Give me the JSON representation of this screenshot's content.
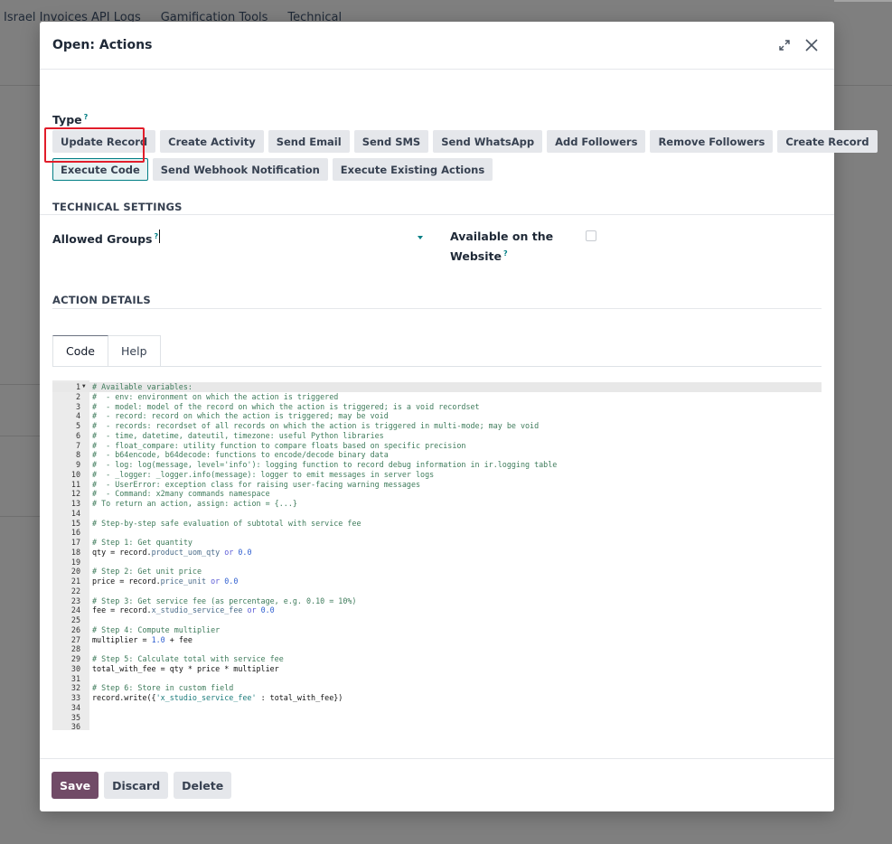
{
  "background": {
    "menu": [
      "Israel Invoices API Logs",
      "Gamification Tools",
      "Technical"
    ]
  },
  "modal": {
    "title": "Open: Actions",
    "expand_icon": "expand-icon",
    "close_icon": "close-icon"
  },
  "type_field": {
    "label": "Type",
    "help": "?",
    "row1": [
      "Update Record",
      "Create Activity",
      "Send Email",
      "Send SMS",
      "Send WhatsApp",
      "Add Followers",
      "Remove Followers",
      "Create Record"
    ],
    "row2": [
      "Execute Code",
      "Send Webhook Notification",
      "Execute Existing Actions"
    ],
    "selected": "Execute Code"
  },
  "technical_settings": {
    "title": "TECHNICAL SETTINGS",
    "allowed_groups_label": "Allowed Groups",
    "allowed_groups_value": "",
    "available_on_website_label_1": "Available on the",
    "available_on_website_label_2": "Website",
    "available_on_website_checked": false,
    "help": "?"
  },
  "action_details": {
    "title": "ACTION DETAILS",
    "tabs": [
      "Code",
      "Help"
    ],
    "active_tab": "Code"
  },
  "code_lines": [
    "# Available variables:",
    "#  - env: environment on which the action is triggered",
    "#  - model: model of the record on which the action is triggered; is a void recordset",
    "#  - record: record on which the action is triggered; may be void",
    "#  - records: recordset of all records on which the action is triggered in multi-mode; may be void",
    "#  - time, datetime, dateutil, timezone: useful Python libraries",
    "#  - float_compare: utility function to compare floats based on specific precision",
    "#  - b64encode, b64decode: functions to encode/decode binary data",
    "#  - log: log(message, level='info'): logging function to record debug information in ir.logging table",
    "#  - _logger: _logger.info(message): logger to emit messages in server logs",
    "#  - UserError: exception class for raising user-facing warning messages",
    "#  - Command: x2many commands namespace",
    "# To return an action, assign: action = {...}",
    "",
    "# Step-by-step safe evaluation of subtotal with service fee",
    "",
    "# Step 1: Get quantity",
    "qty = record.product_uom_qty or 0.0",
    "",
    "# Step 2: Get unit price",
    "price = record.price_unit or 0.0",
    "",
    "# Step 3: Get service fee (as percentage, e.g. 0.10 = 10%)",
    "fee = record.x_studio_service_fee or 0.0",
    "",
    "# Step 4: Compute multiplier",
    "multiplier = 1.0 + fee",
    "",
    "# Step 5: Calculate total with service fee",
    "total_with_fee = qty * price * multiplier",
    "",
    "# Step 6: Store in custom field",
    "record.write({'x_studio_service_fee' : total_with_fee})",
    "",
    "",
    ""
  ],
  "footer": {
    "save": "Save",
    "discard": "Discard",
    "delete": "Delete"
  },
  "colors": {
    "primary": "#714b67",
    "accent": "#017e84",
    "highlight": "#e11d2a"
  }
}
